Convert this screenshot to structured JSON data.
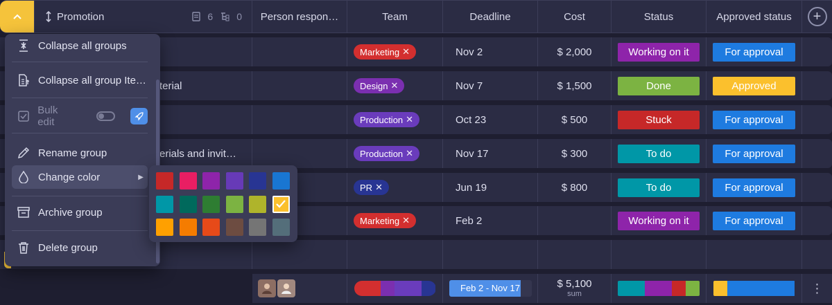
{
  "header": {
    "group_name": "Promotion",
    "items_count": "6",
    "subitems_count": "0",
    "columns": {
      "person": "Person respon…",
      "team": "Team",
      "deadline": "Deadline",
      "cost": "Cost",
      "status": "Status",
      "approved": "Approved status"
    },
    "add_label": "+"
  },
  "rows": [
    {
      "name": "",
      "team": "Marketing",
      "team_color": "#d32f2f",
      "deadline": "Nov 2",
      "cost": "$ 2,000",
      "status": "Working on it",
      "status_color": "#8e24aa",
      "approved": "For approval",
      "approved_color": "#1e7be0"
    },
    {
      "name": "terial",
      "team": "Design",
      "team_color": "#7b2fb0",
      "deadline": "Nov 7",
      "cost": "$ 1,500",
      "status": "Done",
      "status_color": "#7cb342",
      "approved": "Approved",
      "approved_color": "#fbc02d"
    },
    {
      "name": "",
      "team": "Production",
      "team_color": "#6a3cbc",
      "deadline": "Oct 23",
      "cost": "$ 500",
      "status": "Stuck",
      "status_color": "#c62828",
      "approved": "For approval",
      "approved_color": "#1e7be0"
    },
    {
      "name": "erials and invit…",
      "team": "Production",
      "team_color": "#6a3cbc",
      "deadline": "Nov 17",
      "cost": "$ 300",
      "status": "To do",
      "status_color": "#0097a7",
      "approved": "For approval",
      "approved_color": "#1e7be0"
    },
    {
      "name": "",
      "team": "PR",
      "team_color": "#283593",
      "deadline": "Jun 19",
      "cost": "$ 800",
      "status": "To do",
      "status_color": "#0097a7",
      "approved": "For approval",
      "approved_color": "#1e7be0"
    },
    {
      "name": "",
      "team": "Marketing",
      "team_color": "#d32f2f",
      "deadline": "Feb 2",
      "cost": "",
      "status": "Working on it",
      "status_color": "#8e24aa",
      "approved": "For approval",
      "approved_color": "#1e7be0"
    }
  ],
  "summary": {
    "date_range": "Feb 2 - Nov 17",
    "date_range_fill_fraction": 0.87,
    "cost_sum": "$ 5,100",
    "cost_label": "sum",
    "menu_icon": "⋮",
    "team_segments": [
      {
        "color": "#d32f2f",
        "fraction": 0.33
      },
      {
        "color": "#7b2fb0",
        "fraction": 0.17
      },
      {
        "color": "#6a3cbc",
        "fraction": 0.33
      },
      {
        "color": "#283593",
        "fraction": 0.17
      }
    ],
    "status_segments": [
      {
        "color": "#0097a7",
        "fraction": 0.33
      },
      {
        "color": "#8e24aa",
        "fraction": 0.33
      },
      {
        "color": "#c62828",
        "fraction": 0.17
      },
      {
        "color": "#7cb342",
        "fraction": 0.17
      }
    ],
    "approved_segments": [
      {
        "color": "#fbc02d",
        "fraction": 0.17
      },
      {
        "color": "#1e7be0",
        "fraction": 0.83
      }
    ]
  },
  "menu": {
    "collapse_all": "Collapse all groups",
    "collapse_items": "Collapse all group Ite…",
    "bulk_edit": "Bulk edit",
    "rename": "Rename group",
    "change_color": "Change color",
    "archive": "Archive group",
    "delete": "Delete group"
  },
  "palette": [
    "#c62828",
    "#e91e63",
    "#8e24aa",
    "#673ab7",
    "#283593",
    "#1976d2",
    "#0097a7",
    "#00695c",
    "#2e7d32",
    "#7cb342",
    "#afb42b",
    "#fbc02d",
    "#ffa000",
    "#f57c00",
    "#e64a19",
    "#6d4c41",
    "#757575",
    "#546e7a"
  ],
  "palette_selected_index": 11
}
